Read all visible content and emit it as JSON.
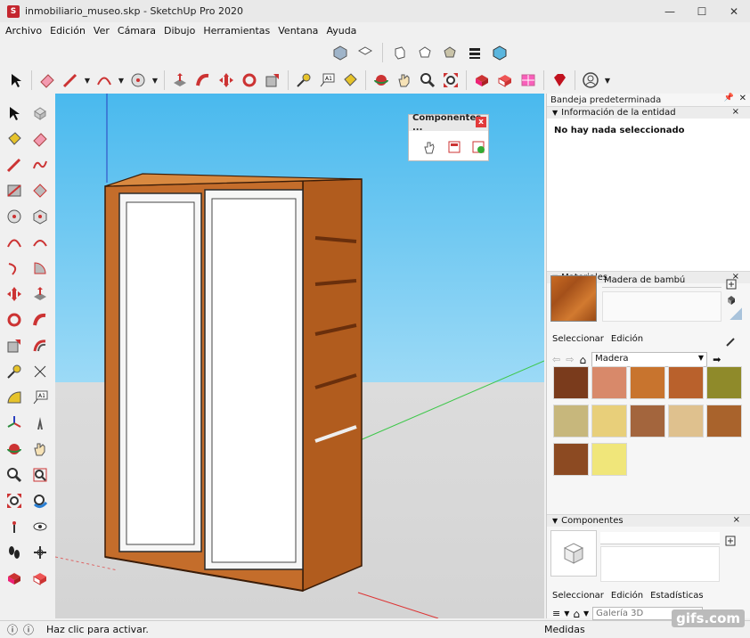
{
  "window": {
    "title": "inmobiliario_museo.skp - SketchUp Pro 2020",
    "app_icon": "sketchup-icon"
  },
  "menu": [
    "Archivo",
    "Edición",
    "Ver",
    "Cámara",
    "Dibujo",
    "Herramientas",
    "Ventana",
    "Ayuda"
  ],
  "views_toolbar": [
    "iso-view-icon",
    "top-view-icon",
    "front-view-icon",
    "right-view-icon",
    "back-view-icon",
    "left-view-icon",
    "style-xray-icon"
  ],
  "main_toolbar": [
    "select-icon",
    "eraser-icon",
    "pencil-icon",
    "arc-icon",
    "circle-icon",
    "push-pull-icon",
    "follow-me-icon",
    "move-icon",
    "rotate-icon",
    "scale-icon",
    "tape-measure-icon",
    "text-icon",
    "paint-bucket-icon",
    "orbit-icon",
    "pan-icon",
    "zoom-icon",
    "zoom-extents-icon",
    "warehouse-icon",
    "extension-warehouse-icon",
    "layout-icon",
    "ruby-icon",
    "account-icon"
  ],
  "float_panel": {
    "title": "Componentes ...",
    "close": "x"
  },
  "tray": {
    "title": "Bandeja predeterminada",
    "entity_info": {
      "header": "Información de la entidad",
      "text": "No hay nada seleccionado"
    },
    "materials": {
      "header": "Materiales",
      "name_value": "Madera de bambú",
      "tab_select": "Seleccionar",
      "tab_edit": "Edición",
      "library": "Madera",
      "swatches": [
        "#7a3b1c",
        "#d8896a",
        "#c8742e",
        "#b9612c",
        "#8f8a2a",
        "#c7b77c",
        "#e8cf7a",
        "#a3653d",
        "#dfc18e",
        "#a9632c",
        "#8c4a22",
        "#f0e67a"
      ]
    },
    "components": {
      "header": "Componentes",
      "tab_select": "Seleccionar",
      "tab_edit": "Edición",
      "tab_stats": "Estadísticas",
      "search_placeholder": "Galería 3D"
    }
  },
  "status": {
    "text": "Haz clic para activar.",
    "measure_label": "Medidas"
  },
  "watermark": "gifs.com"
}
